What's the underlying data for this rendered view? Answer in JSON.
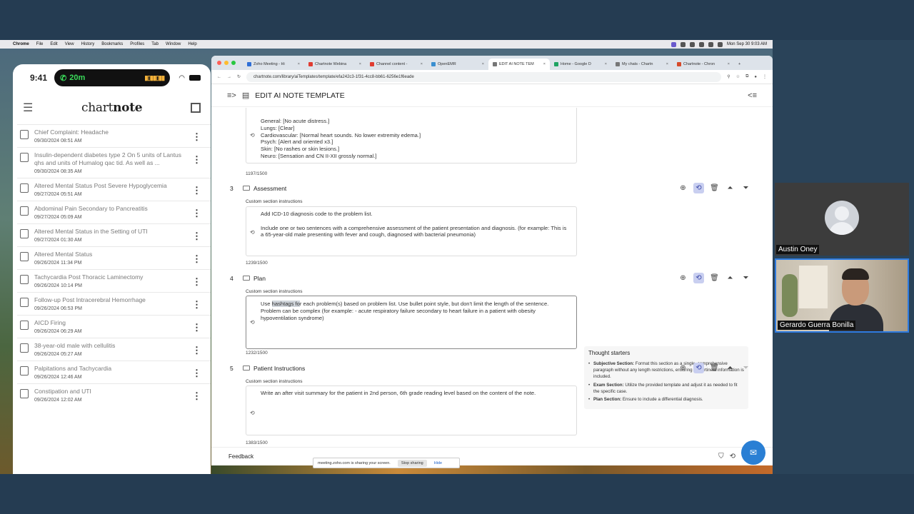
{
  "menubar": {
    "app": "Chrome",
    "items": [
      "File",
      "Edit",
      "View",
      "History",
      "Bookmarks",
      "Profiles",
      "Tab",
      "Window",
      "Help"
    ],
    "clock": "Mon Sep 30 9:03 AM"
  },
  "phone": {
    "time": "9:41",
    "call_timer": "20m",
    "logo_plain": "chart",
    "logo_bold": "note",
    "notes": [
      {
        "title": "Chief Complaint: Headache",
        "date": "09/30/2024 08:51 AM"
      },
      {
        "title": "Insulin-dependent diabetes type 2 On 5 units of Lantus qhs and units of Humalog qac tid. As well as ...",
        "date": "09/30/2024 08:35 AM"
      },
      {
        "title": "Altered Mental Status Post Severe Hypoglycemia",
        "date": "09/27/2024 05:51 AM"
      },
      {
        "title": "Abdominal Pain Secondary to Pancreatitis",
        "date": "09/27/2024 05:09 AM"
      },
      {
        "title": "Altered Mental Status in the Setting of UTI",
        "date": "09/27/2024 01:30 AM"
      },
      {
        "title": "Altered Mental Status",
        "date": "09/26/2024 11:34 PM"
      },
      {
        "title": "Tachycardia Post Thoracic Laminectomy",
        "date": "09/26/2024 10:14 PM"
      },
      {
        "title": "Follow-up Post Intracerebral Hemorrhage",
        "date": "09/26/2024 06:53 PM"
      },
      {
        "title": "AICD Firing",
        "date": "09/26/2024 06:29 AM"
      },
      {
        "title": "38-year-old male with cellulitis",
        "date": "09/26/2024 05:27 AM"
      },
      {
        "title": "Palpitations and Tachycardia",
        "date": "09/26/2024 12:46 AM"
      },
      {
        "title": "Constipation and UTI",
        "date": "09/26/2024 12:02 AM"
      }
    ]
  },
  "browser": {
    "tabs": [
      {
        "label": "Zoho Meeting - Hi",
        "color": "#2f6fd6"
      },
      {
        "label": "Chartnote Webina",
        "color": "#e03c31"
      },
      {
        "label": "Channel content -",
        "color": "#e03c31"
      },
      {
        "label": "OpenEMR",
        "color": "#3a8fd0"
      },
      {
        "label": "EDIT AI NOTE TEM",
        "color": "#777777"
      },
      {
        "label": "Home - Google D",
        "color": "#1ea362"
      },
      {
        "label": "My chats - Chartn",
        "color": "#777777"
      },
      {
        "label": "Chartnote - Chron",
        "color": "#d64a2a"
      }
    ],
    "url": "chartnote.com/library/aiTemplates/template/efa242c3-1f31-4cc8-bb61-6256e1f6eade"
  },
  "app": {
    "page_title": "EDIT AI NOTE TEMPLATE",
    "exam_text": "General: [No acute distress.]\nLungs: [Clear]\nCardiovascular: [Normal heart sounds. No lower extremity edema.]\nPsych: [Alert and oriented x3.]\nSkin: [No rashes or skin lesions.]\nNeuro: [Sensation and CN II-XII grossly normal.]",
    "exam_counter": "1197/1500",
    "custom_label": "Custom section instructions",
    "sections": [
      {
        "num": "3",
        "name": "Assessment",
        "text": "Add ICD-10 diagnosis code to the problem list.\n\nInclude one or two sentences with a comprehensive assessment of the patient presentation and diagnosis. (for example: This is a 65-year-old male presenting with fever and cough, diagnosed with bacterial pneumonia)",
        "counter": "1239/1500"
      },
      {
        "num": "4",
        "name": "Plan",
        "text_pre": "Use ",
        "text_hl": "hashtags fo",
        "text_post": "r each problem(s) based on problem list. Use bullet point style, but don't limit the length of the sentence.\nProblem can be complex (for example: - acute respiratory failure secondary to heart failure in a patient with obesity hypoventilation syndrome)",
        "counter": "1232/1500"
      },
      {
        "num": "5",
        "name": "Patient Instructions",
        "text": "Write an after visit summary for the patient in 2nd person, 6th grade reading level based on the content of the note.",
        "counter": "1383/1500"
      }
    ],
    "thought_starters": {
      "title": "Thought starters",
      "items": [
        {
          "label": "Subjective Section:",
          "text": " Format this section as a single, comprehensive paragraph without any length restrictions, ensuring all pertinent information is included."
        },
        {
          "label": "Exam Section:",
          "text": " Utilize the provided template and adjust it as needed to fit the specific case."
        },
        {
          "label": "Plan Section:",
          "text": " Ensure to include a differential diagnosis."
        }
      ]
    },
    "feedback": "Feedback"
  },
  "share_bar": {
    "text": "meeting.zoho.com is sharing your screen.",
    "stop": "Stop sharing",
    "hide": "Hide"
  },
  "participants": {
    "a": "Austin Oney",
    "b": "Gerardo Guerra Bonilla"
  }
}
